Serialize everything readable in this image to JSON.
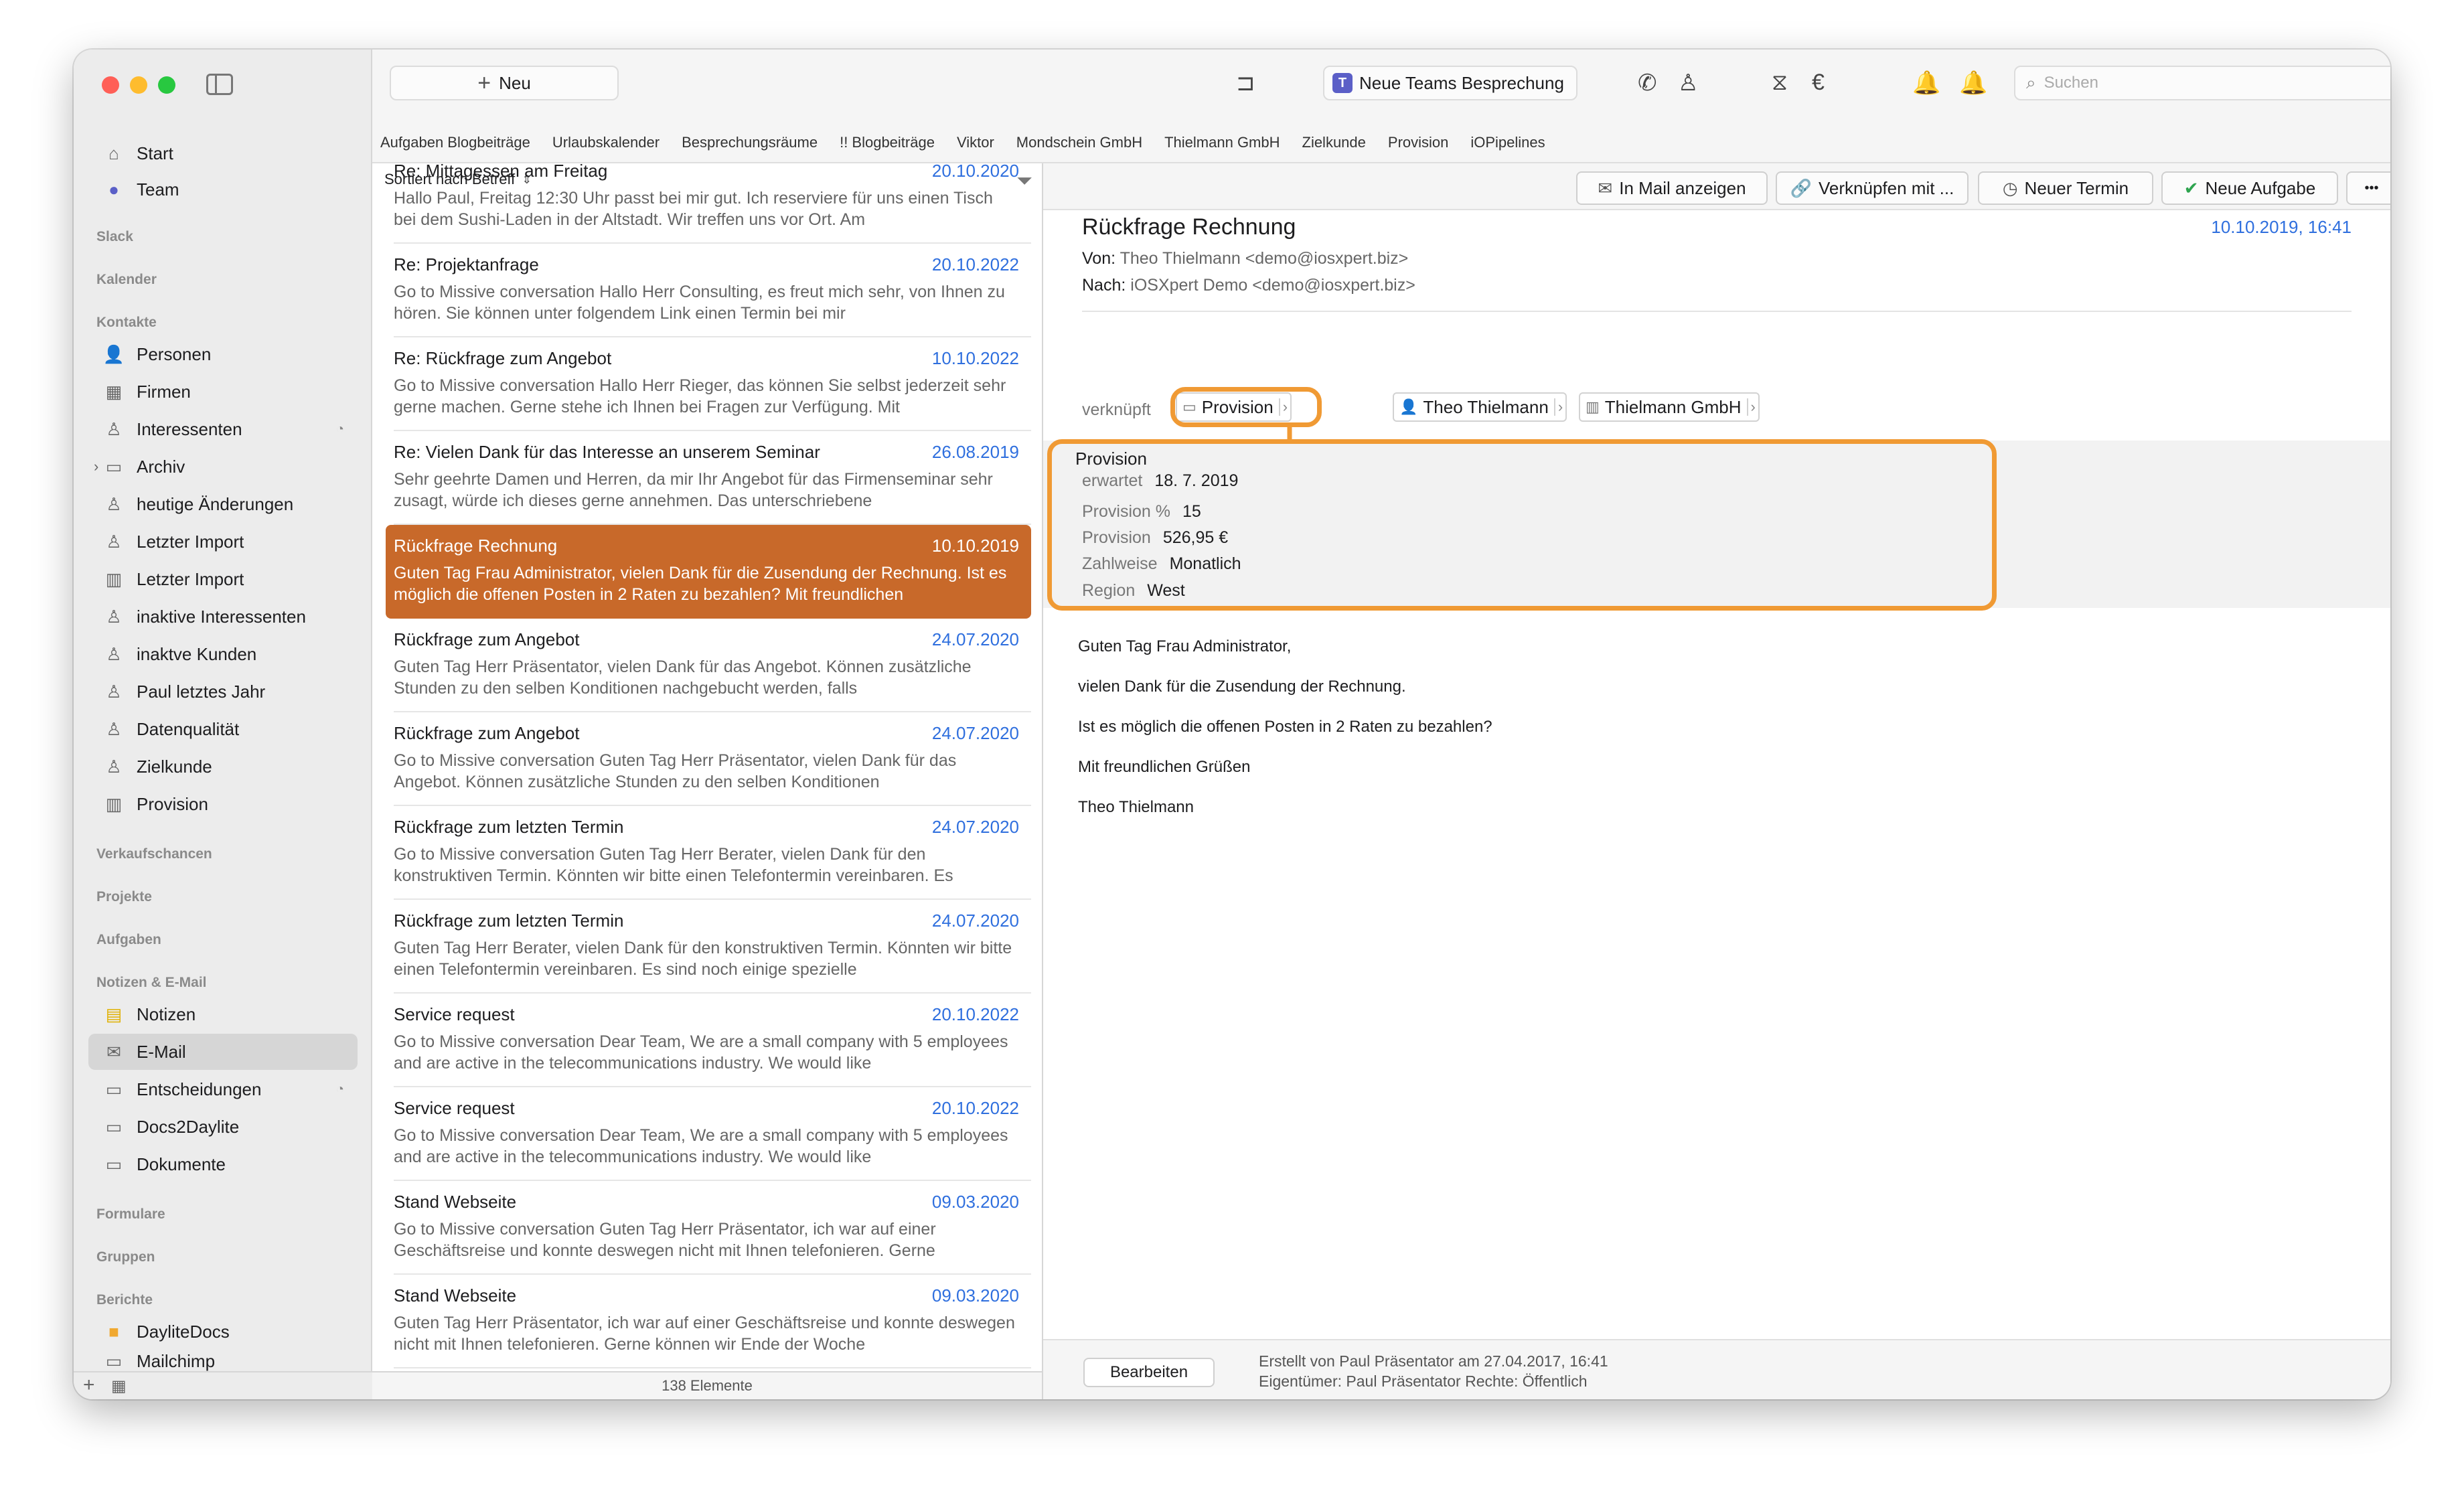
{
  "sidebar": {
    "items": [
      {
        "label": "Start",
        "icon": "house-icon"
      },
      {
        "label": "Team",
        "icon": "team-icon"
      }
    ],
    "sections": [
      "Slack",
      "Kalender",
      "Kontakte",
      "Verkaufschancen",
      "Projekte",
      "Aufgaben",
      "Notizen & E-Mail",
      "Formulare",
      "Gruppen",
      "Berichte"
    ],
    "kontakte": [
      "Personen",
      "Firmen",
      "Interessenten",
      "Archiv",
      "heutige Änderungen",
      "Letzter Import",
      "Letzter Import",
      "inaktive Interessenten",
      "inaktve Kunden",
      "Paul letztes Jahr",
      "Datenqualität",
      "Zielkunde",
      "Provision"
    ],
    "notizen": [
      "Notizen",
      "E-Mail",
      "Entscheidungen",
      "Docs2Daylite",
      "Dokumente"
    ],
    "berichte": [
      "DayliteDocs",
      "Mailchimp"
    ]
  },
  "toolbar": {
    "new_label": "Neu",
    "teams_label": "Neue Teams Besprechung",
    "search_placeholder": "Suchen"
  },
  "bookmarks": [
    "Aufgaben Blogbeiträge",
    "Urlaubskalender",
    "Besprechungsräume",
    "!! Blogbeiträge",
    "Viktor",
    "Mondschein GmbH",
    "Thielmann GmbH",
    "Zielkunde",
    "Provision",
    "iOPipelines"
  ],
  "list": {
    "sort_label": "Sortiert nach Betreff",
    "top_partial": {
      "subject": "Re: Mittagessen am Freitag",
      "date": "20.10.2020",
      "preview": "Hallo Paul, Freitag 12:30 Uhr passt bei mir gut. Ich reserviere für uns einen Tisch bei dem Sushi-Laden in der Altstadt. Wir treffen uns vor Ort. Am"
    },
    "messages": [
      {
        "subject": "Re: Projektanfrage",
        "date": "20.10.2022",
        "preview": "Go to Missive conversation Hallo Herr Consulting, es freut mich sehr, von Ihnen zu hören. Sie können unter folgendem Link einen Termin bei mir"
      },
      {
        "subject": "Re: Rückfrage zum Angebot",
        "date": "10.10.2022",
        "preview": "Go to Missive conversation Hallo Herr Rieger, das können Sie selbst jederzeit sehr gerne machen. Gerne stehe ich Ihnen bei Fragen zur Verfügung. Mit"
      },
      {
        "subject": "Re: Vielen Dank für das Interesse an unserem Seminar",
        "date": "26.08.2019",
        "preview": "Sehr geehrte Damen und Herren, da mir Ihr Angebot für das Firmenseminar sehr zusagt, würde ich dieses gerne annehmen. Das unterschriebene"
      },
      {
        "subject": "Rückfrage Rechnung",
        "date": "10.10.2019",
        "preview": "Guten Tag Frau Administrator, vielen Dank für die Zusendung der Rechnung. Ist es möglich die offenen Posten in 2 Raten zu bezahlen? Mit freundlichen"
      },
      {
        "subject": "Rückfrage zum Angebot",
        "date": "24.07.2020",
        "preview": "Guten Tag Herr Präsentator, vielen Dank für das Angebot. Können zusätzliche Stunden zu den selben Konditionen nachgebucht werden, falls"
      },
      {
        "subject": "Rückfrage zum Angebot",
        "date": "24.07.2020",
        "preview": "Go to Missive conversation Guten Tag Herr Präsentator, vielen Dank für das Angebot. Können zusätzliche Stunden zu den selben Konditionen"
      },
      {
        "subject": "Rückfrage zum letzten Termin",
        "date": "24.07.2020",
        "preview": "Go to Missive conversation Guten Tag Herr Berater, vielen Dank für den konstruktiven Termin. Könnten wir bitte einen Telefontermin vereinbaren. Es"
      },
      {
        "subject": "Rückfrage zum letzten Termin",
        "date": "24.07.2020",
        "preview": "Guten Tag Herr Berater, vielen Dank für den konstruktiven Termin. Könnten wir bitte einen Telefontermin vereinbaren. Es sind noch einige spezielle"
      },
      {
        "subject": "Service request",
        "date": "20.10.2022",
        "preview": "Go to Missive conversation Dear Team, We are a small company with 5 employees and are active in the telecommunications industry. We would like"
      },
      {
        "subject": "Service request",
        "date": "20.10.2022",
        "preview": "Go to Missive conversation Dear Team, We are a small company with 5 employees and are active in the telecommunications industry. We would like"
      },
      {
        "subject": "Stand Webseite",
        "date": "09.03.2020",
        "preview": "Go to Missive conversation Guten Tag Herr Präsentator, ich war auf einer Geschäftsreise und konnte deswegen nicht mit Ihnen telefonieren. Gerne"
      },
      {
        "subject": "Stand Webseite",
        "date": "09.03.2020",
        "preview": "Guten Tag Herr Präsentator, ich war auf einer Geschäftsreise und konnte deswegen nicht mit Ihnen telefonieren. Gerne können wir Ende der Woche"
      }
    ],
    "count_label": "138 Elemente"
  },
  "detail": {
    "buttons": {
      "show_in_mail": "In Mail anzeigen",
      "link_with": "Verknüpfen mit ...",
      "new_appointment": "Neuer Termin",
      "new_task": "Neue Aufgabe",
      "more": "•••"
    },
    "title": "Rückfrage Rechnung",
    "date": "10.10.2019, 16:41",
    "from_label": "Von:",
    "from_value": "Theo Thielmann <demo@iosxpert.biz>",
    "to_label": "Nach:",
    "to_value": "iOSXpert Demo <demo@iosxpert.biz>",
    "linked_label": "verknüpft",
    "links": [
      "Provision",
      "Theo Thielmann",
      "Thielmann GmbH"
    ],
    "fields_title": "Provision",
    "fields": [
      {
        "key": "erwartet",
        "value": "18.  7. 2019"
      },
      {
        "key": "Provision %",
        "value": "15"
      },
      {
        "key": "Provision",
        "value": "526,95 €"
      },
      {
        "key": "Zahlweise",
        "value": "Monatlich"
      },
      {
        "key": "Region",
        "value": "West"
      }
    ],
    "body": [
      "Guten Tag Frau Administrator,",
      "vielen Dank für die Zusendung der Rechnung.",
      "Ist es möglich die offenen Posten in 2 Raten zu bezahlen?",
      "Mit freundlichen Grüßen",
      "Theo Thielmann"
    ],
    "footer": {
      "edit_label": "Bearbeiten",
      "created": "Erstellt von Paul Präsentator am 27.04.2017, 16:41",
      "owner": "Eigentümer:  Paul Präsentator     Rechte:  Öffentlich"
    },
    "accent_color": "#f09a34",
    "selection_color": "#c8692a",
    "date_color": "#2f6fde"
  }
}
